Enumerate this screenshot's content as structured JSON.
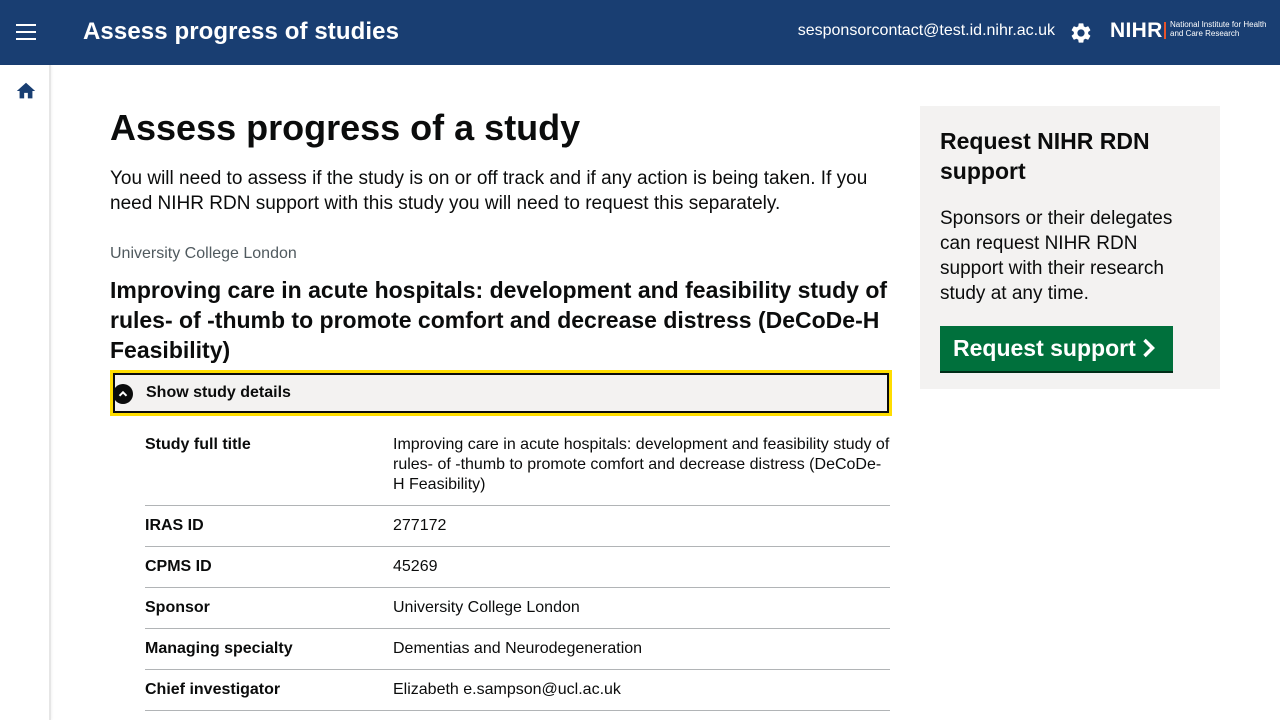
{
  "header": {
    "app_title": "Assess progress of studies",
    "user_email": "sesponsorcontact@test.id.nihr.ac.uk",
    "logo_mark": "NIHR",
    "logo_subtitle": "National Institute for Health and Care Research"
  },
  "main": {
    "page_title": "Assess progress of a study",
    "intro": "You will need to assess if the study is on or off track and if any action is being taken. If you need NIHR RDN support with this study you will need to request this separately.",
    "organisation": "University College London",
    "study_title": "Improving care in acute hospitals: development and feasibility study of rules- of -thumb to promote comfort and decrease distress (DeCoDe-H Feasibility)",
    "details_toggle_label": "Show study details",
    "summary": [
      {
        "key": "Study full title",
        "value": "Improving care in acute hospitals: development and feasibility study of rules- of -thumb to promote comfort and decrease distress (DeCoDe-H Feasibility)"
      },
      {
        "key": "IRAS ID",
        "value": "277172"
      },
      {
        "key": "CPMS ID",
        "value": "45269"
      },
      {
        "key": "Sponsor",
        "value": "University College London"
      },
      {
        "key": "Managing specialty",
        "value": "Dementias and Neurodegeneration"
      },
      {
        "key": "Chief investigator",
        "value": "Elizabeth e.sampson@ucl.ac.uk"
      }
    ]
  },
  "aside": {
    "heading": "Request NIHR RDN support",
    "body": "Sponsors or their delegates can request NIHR RDN support with their research study at any time.",
    "button_label": "Request support"
  },
  "colors": {
    "header_bg": "#193e72",
    "button_green": "#00703c",
    "focus_yellow": "#ffdd00",
    "panel_grey": "#f3f2f1"
  }
}
